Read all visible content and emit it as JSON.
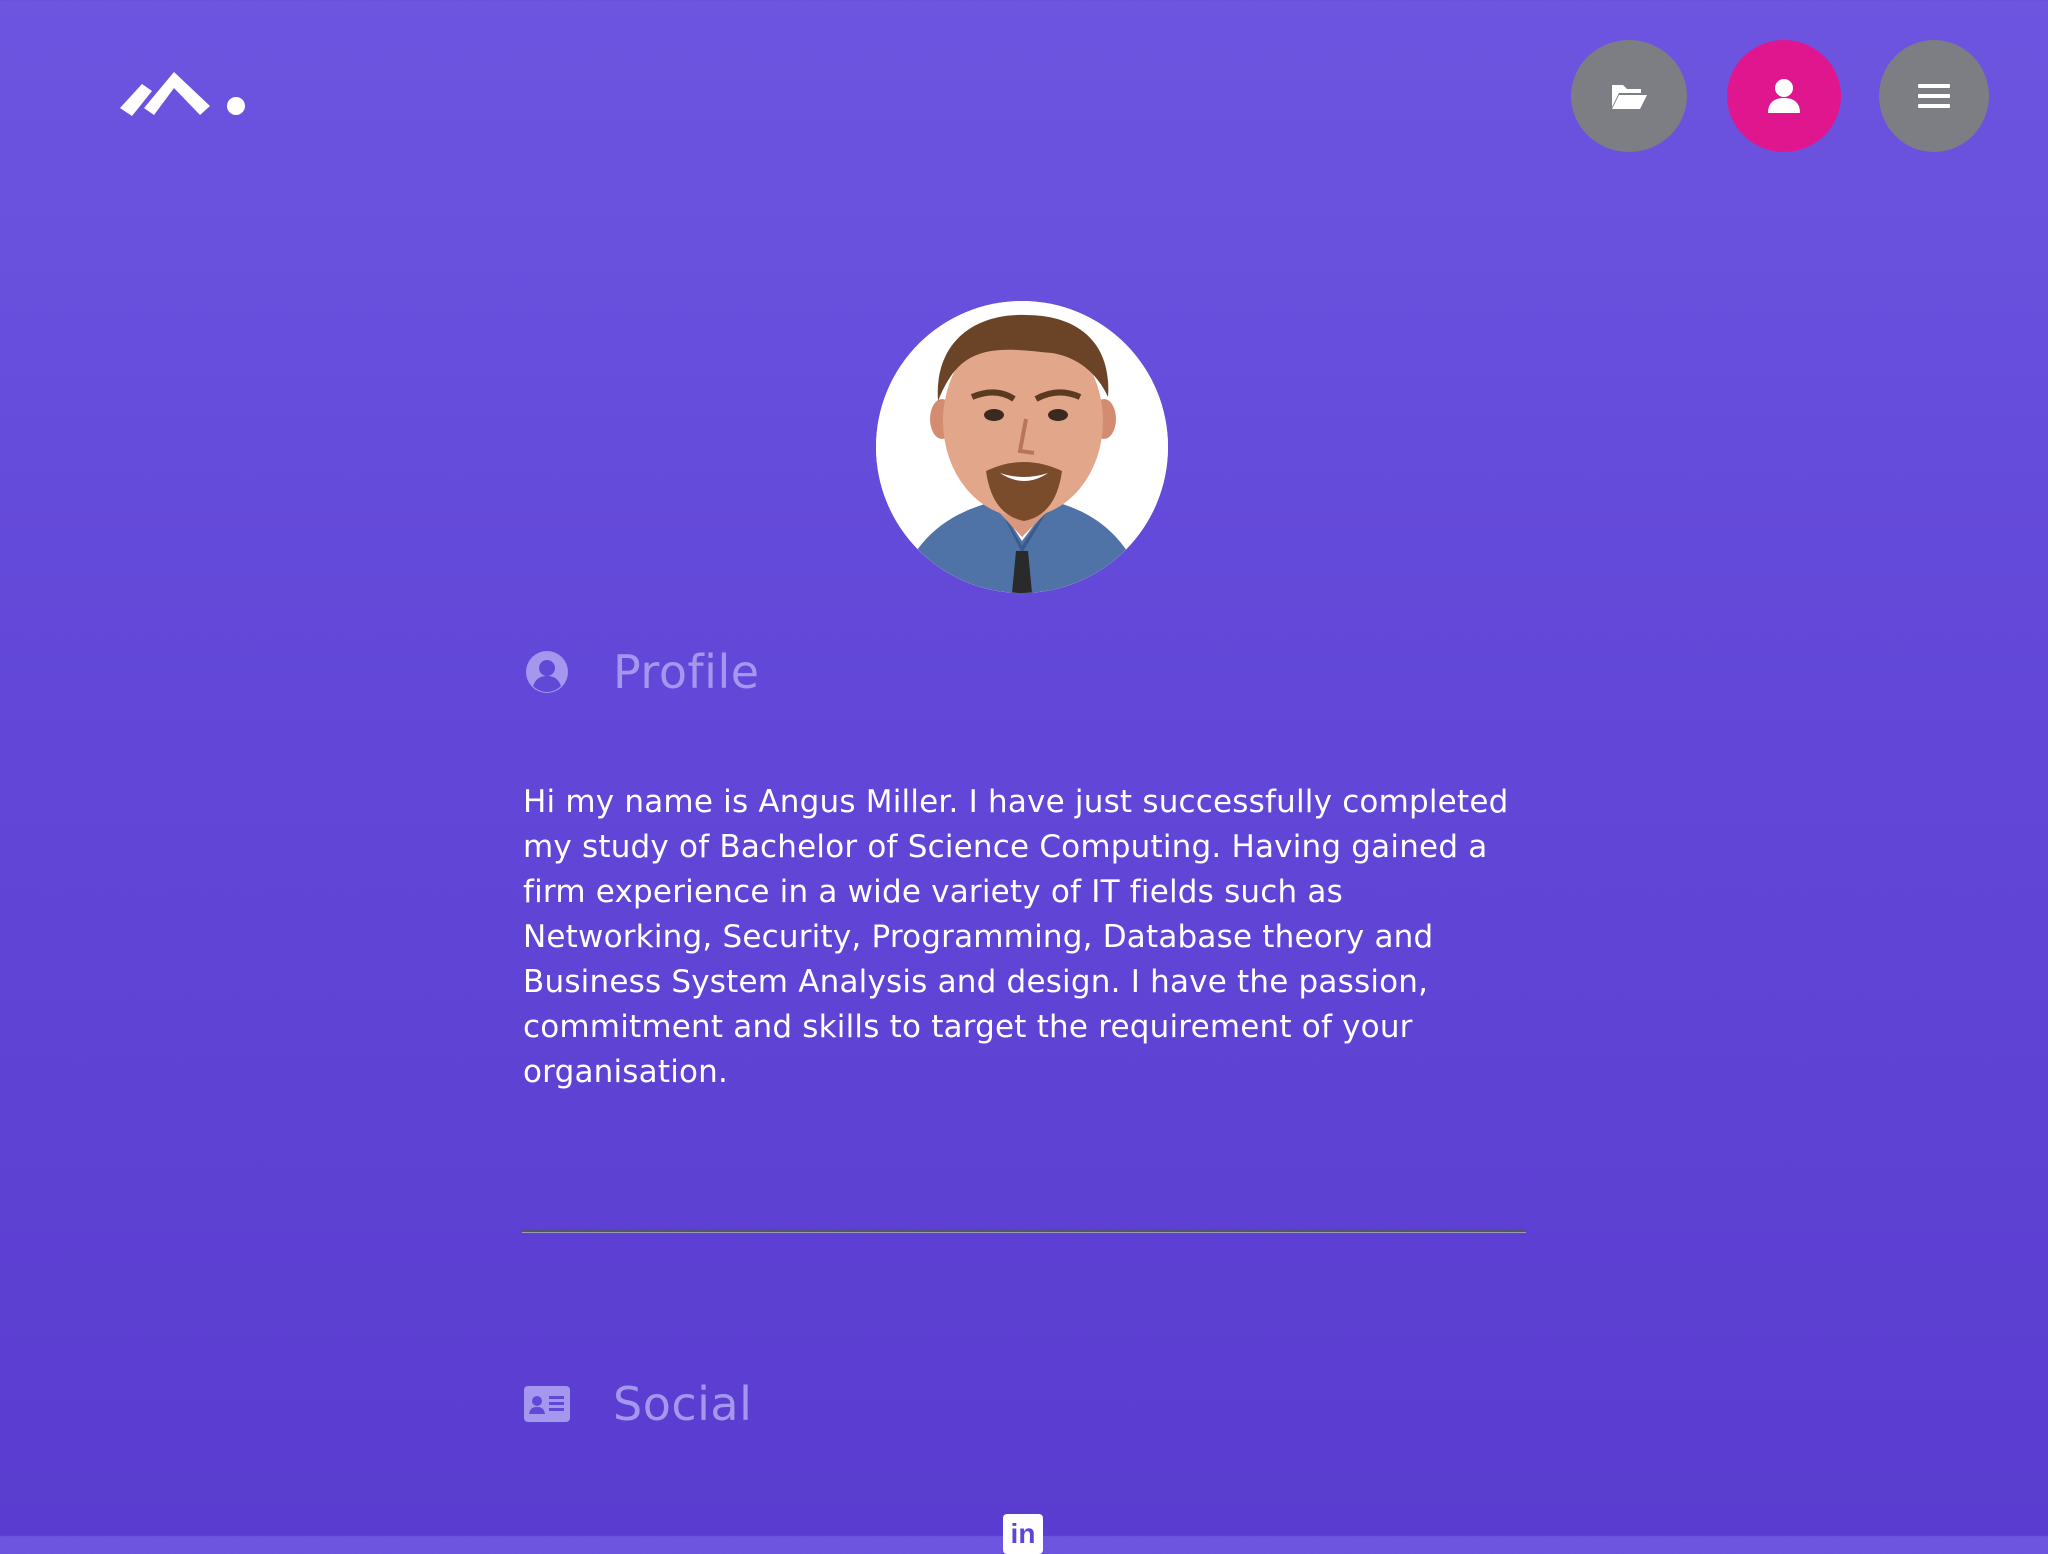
{
  "header": {
    "logo": {
      "icon": "logo-mark"
    },
    "nav": [
      {
        "name": "projects",
        "icon": "folder-open-icon",
        "color": "#7d7d84"
      },
      {
        "name": "profile",
        "icon": "user-icon",
        "color": "#e0168f",
        "active": true
      },
      {
        "name": "menu",
        "icon": "hamburger-icon",
        "color": "#7d7d84"
      }
    ]
  },
  "profile": {
    "heading": "Profile",
    "icon": "user-circle-icon",
    "bio": "Hi my name is Angus Miller. I have just successfully completed my study of Bachelor of Science Computing. Having gained a firm experience in a wide variety of IT fields such as Networking, Security, Programming, Database theory and Business System Analysis and design. I have the passion, commitment and skills to target the requirement of your organisation."
  },
  "social": {
    "heading": "Social",
    "icon": "id-card-icon",
    "links": [
      {
        "name": "linkedin",
        "icon": "linkedin-icon",
        "label": "in"
      }
    ]
  },
  "colors": {
    "background_top": "#6d55e0",
    "background_bottom": "#5a3dd0",
    "accent": "#e0168f",
    "heading": "#a597ee"
  }
}
